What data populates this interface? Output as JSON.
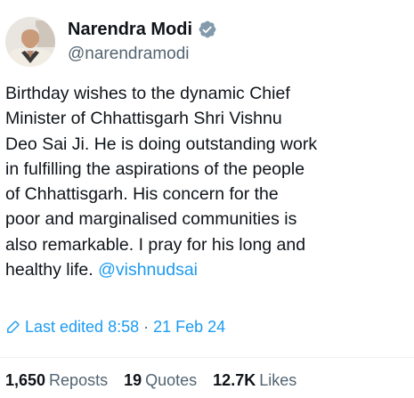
{
  "author": {
    "display_name": "Narendra Modi",
    "handle": "@narendramodi",
    "verified": true,
    "avatar": "profile-photo"
  },
  "tweet": {
    "text": "Birthday wishes to the dynamic Chief\nMinister of Chhattisgarh Shri Vishnu\nDeo Sai Ji. He is doing outstanding work\nin fulfilling the aspirations of the people\nof Chhattisgarh. His concern for the\npoor and marginalised communities is\nalso remarkable. I pray for his long and\nhealthy life. ",
    "mention": "@vishnudsai"
  },
  "edited": {
    "label": "Last edited 8:58",
    "separator": "·",
    "date": "21 Feb 24",
    "icon": "pencil-icon"
  },
  "stats": [
    {
      "count": "1,650",
      "label": "Reposts"
    },
    {
      "count": "19",
      "label": "Quotes"
    },
    {
      "count": "12.7K",
      "label": "Likes"
    }
  ],
  "colors": {
    "link": "#1d9bf0",
    "text": "#0f1419",
    "secondary": "#536471",
    "verified_badge": "#829aab"
  }
}
